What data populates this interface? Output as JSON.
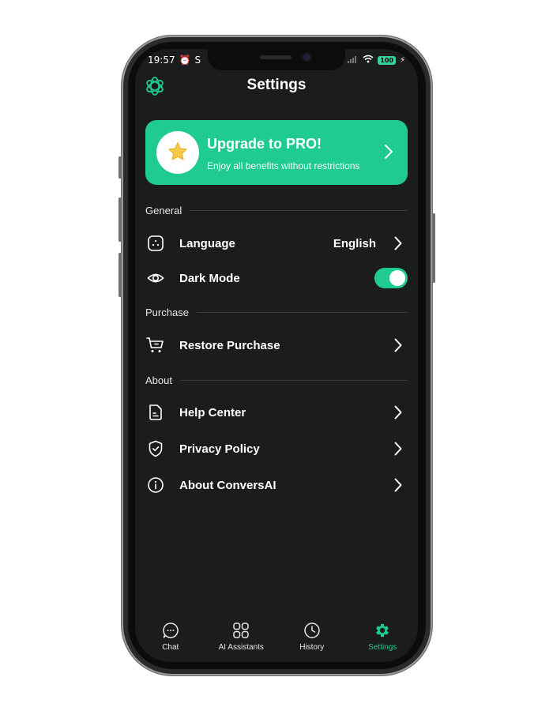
{
  "status_bar": {
    "time": "19:57",
    "battery": "100"
  },
  "header": {
    "title": "Settings"
  },
  "pro_card": {
    "title": "Upgrade to PRO!",
    "subtitle": "Enjoy all benefits without restrictions"
  },
  "sections": {
    "general": {
      "title": "General",
      "language": {
        "label": "Language",
        "value": "English"
      },
      "dark_mode": {
        "label": "Dark Mode",
        "enabled": true
      }
    },
    "purchase": {
      "title": "Purchase",
      "restore": {
        "label": "Restore Purchase"
      }
    },
    "about": {
      "title": "About",
      "help": {
        "label": "Help Center"
      },
      "privacy": {
        "label": "Privacy Policy"
      },
      "about_app": {
        "label": "About ConversAI"
      }
    }
  },
  "tabbar": {
    "chat": "Chat",
    "assistants": "AI Assistants",
    "history": "History",
    "settings": "Settings"
  },
  "colors": {
    "accent": "#1fcb8f",
    "background": "#1b1c1e",
    "star": "#f7c948"
  }
}
